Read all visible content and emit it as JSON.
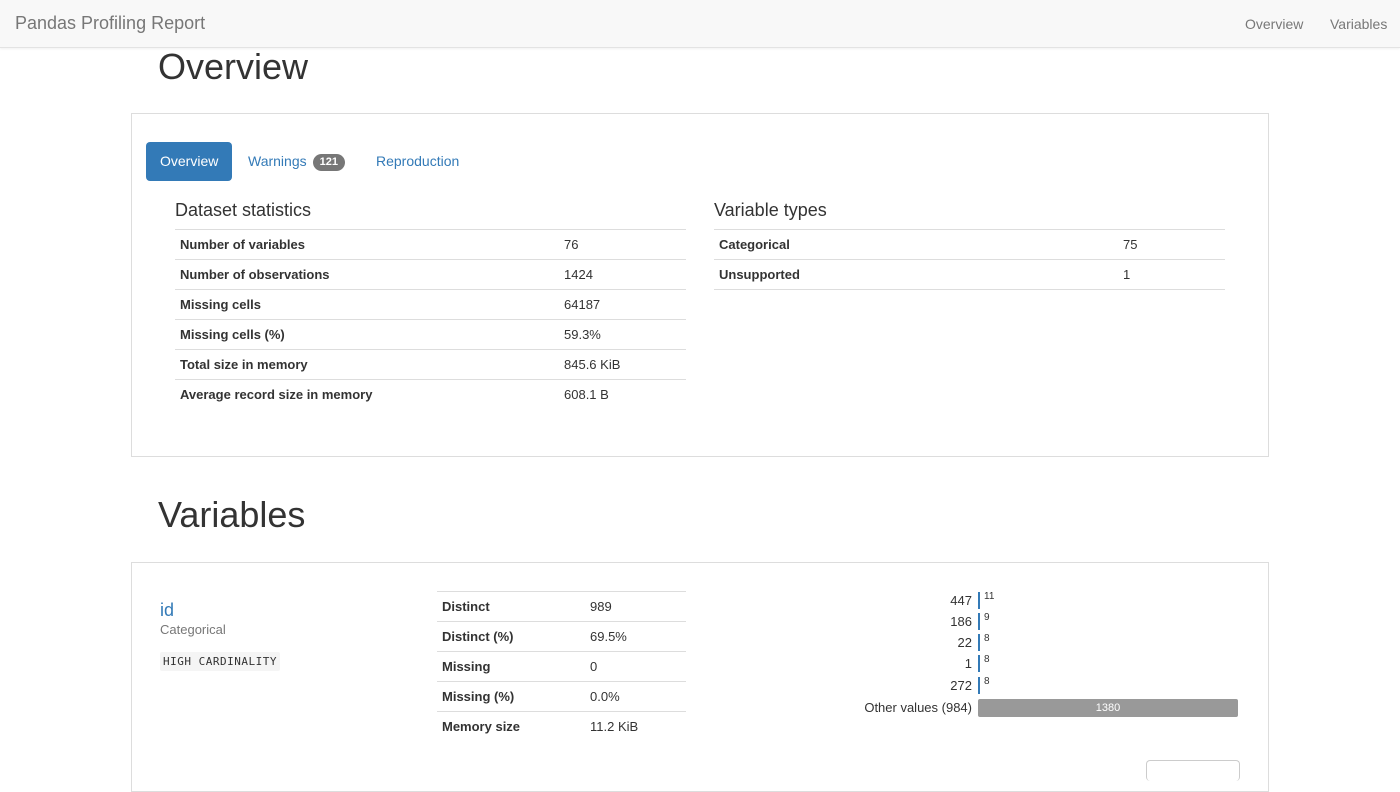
{
  "navbar": {
    "brand": "Pandas Profiling Report",
    "links": [
      "Overview",
      "Variables"
    ]
  },
  "overview": {
    "title": "Overview",
    "tabs": {
      "overview": "Overview",
      "warnings": "Warnings",
      "warnings_count": "121",
      "reproduction": "Reproduction"
    },
    "dataset_statistics": {
      "title": "Dataset statistics",
      "rows": [
        {
          "label": "Number of variables",
          "value": "76"
        },
        {
          "label": "Number of observations",
          "value": "1424"
        },
        {
          "label": "Missing cells",
          "value": "64187"
        },
        {
          "label": "Missing cells (%)",
          "value": "59.3%"
        },
        {
          "label": "Total size in memory",
          "value": "845.6 KiB"
        },
        {
          "label": "Average record size in memory",
          "value": "608.1 B"
        }
      ]
    },
    "variable_types": {
      "title": "Variable types",
      "rows": [
        {
          "label": "Categorical",
          "value": "75"
        },
        {
          "label": "Unsupported",
          "value": "1"
        }
      ]
    }
  },
  "variables": {
    "title": "Variables",
    "first": {
      "name": "id",
      "type": "Categorical",
      "warning": "HIGH CARDINALITY",
      "stats": [
        {
          "label": "Distinct",
          "value": "989"
        },
        {
          "label": "Distinct (%)",
          "value": "69.5%"
        },
        {
          "label": "Missing",
          "value": "0"
        },
        {
          "label": "Missing (%)",
          "value": "0.0%"
        },
        {
          "label": "Memory size",
          "value": "11.2 KiB"
        }
      ],
      "frequencies": [
        {
          "value": "447",
          "count": "11",
          "fraction": 0.008
        },
        {
          "value": "186",
          "count": "9",
          "fraction": 0.0065
        },
        {
          "value": "22",
          "count": "8",
          "fraction": 0.0058
        },
        {
          "value": "1",
          "count": "8",
          "fraction": 0.0058
        },
        {
          "value": "272",
          "count": "8",
          "fraction": 0.0058
        },
        {
          "value": "Other values (984)",
          "count": "1380",
          "fraction": 1.0
        }
      ]
    }
  },
  "colors": {
    "primary": "#337ab7",
    "badge": "#777777",
    "other_bar": "#999999"
  }
}
